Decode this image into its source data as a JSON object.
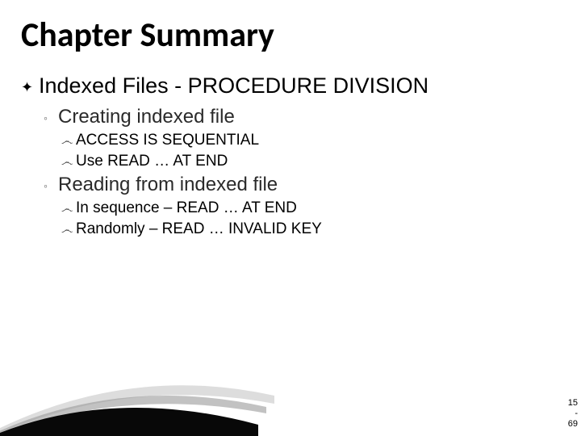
{
  "title": "Chapter Summary",
  "l1": {
    "marker": "✦",
    "text": "Indexed Files - PROCEDURE DIVISION"
  },
  "sections": [
    {
      "l2": {
        "marker": "◦",
        "text": "Creating indexed file"
      },
      "l3": [
        {
          "marker": "෴",
          "text": "ACCESS IS SEQUENTIAL"
        },
        {
          "marker": "෴",
          "text": "Use READ … AT END"
        }
      ]
    },
    {
      "l2": {
        "marker": "◦",
        "text": "Reading from indexed file"
      },
      "l3": [
        {
          "marker": "෴",
          "text": "In sequence – READ … AT END"
        },
        {
          "marker": "෴",
          "text": "Randomly – READ … INVALID KEY"
        }
      ]
    }
  ],
  "page": {
    "top": "15",
    "dash": "-",
    "bottom": "69"
  },
  "colors": {
    "swoosh_dark": "#080808",
    "swoosh_light": "#999999",
    "swoosh_light2": "#bbbbbb"
  }
}
